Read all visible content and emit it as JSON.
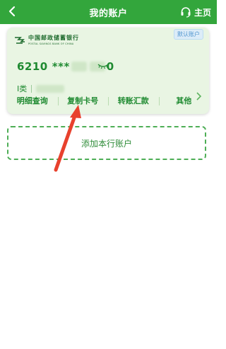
{
  "header": {
    "title": "我的账户",
    "home_label": "主页"
  },
  "card": {
    "bank_name_cn": "中国邮政储蓄银行",
    "bank_name_en": "POSTAL SAVINGS BANK OF CHINA",
    "default_badge": "默认账户",
    "card_number_prefix": "6210",
    "card_number_mask": "***",
    "card_number_suffix": "0",
    "account_type": "I类",
    "actions": [
      {
        "label": "明细查询"
      },
      {
        "label": "复制卡号"
      },
      {
        "label": "转账汇款"
      },
      {
        "label": "其他"
      }
    ]
  },
  "add_account_label": "添加本行账户",
  "colors": {
    "header_bg": "#33a63c",
    "card_bg": "#e9f5e3",
    "accent_green": "#1f8a31",
    "annotation_red": "#e8412d"
  },
  "icons": {
    "back": "chevron-left-icon",
    "home": "headset-icon",
    "eye": "eye-closed-icon",
    "card_more": "chevron-right-icon"
  }
}
